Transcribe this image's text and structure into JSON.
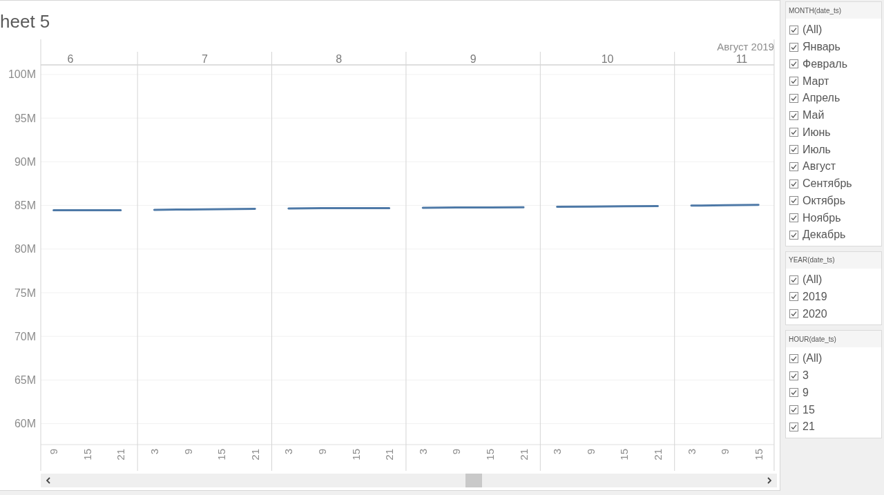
{
  "sheet_title": "heet 5",
  "chart": {
    "header_title": "Август 2019",
    "panes": [
      {
        "header": "6",
        "chart_data": {
          "type": "line",
          "x": [
            9,
            15,
            21
          ],
          "series": [
            {
              "color": "#4e79a7",
              "values": [
                84.45,
                84.46,
                84.46
              ]
            }
          ],
          "xlim": [
            6.7,
            24
          ],
          "ylim": [
            57.6,
            101.1
          ],
          "xticks": [
            9,
            15,
            21
          ],
          "yticks": [
            {
              "value": 60,
              "label": "60M"
            },
            {
              "value": 65,
              "label": "65M"
            },
            {
              "value": 70,
              "label": "70M"
            },
            {
              "value": 75,
              "label": "75M"
            },
            {
              "value": 80,
              "label": "80M"
            },
            {
              "value": 85,
              "label": "85M"
            },
            {
              "value": 90,
              "label": "90M"
            },
            {
              "value": 95,
              "label": "95M"
            },
            {
              "value": 100,
              "label": "100M"
            }
          ],
          "grid": true
        }
      },
      {
        "header": "7",
        "chart_data": {
          "type": "line",
          "x": [
            3,
            9,
            15,
            21
          ],
          "series": [
            {
              "color": "#4e79a7",
              "values": [
                84.5,
                84.54,
                84.58,
                84.62
              ]
            }
          ],
          "xlim": [
            0,
            24
          ],
          "ylim": [
            57.6,
            101.1
          ],
          "xticks": [
            3,
            9,
            15,
            21
          ],
          "grid": true
        }
      },
      {
        "header": "8",
        "chart_data": {
          "type": "line",
          "x": [
            3,
            9,
            15,
            21
          ],
          "series": [
            {
              "color": "#4e79a7",
              "values": [
                84.66,
                84.68,
                84.7,
                84.7
              ]
            }
          ],
          "xlim": [
            0,
            24
          ],
          "ylim": [
            57.6,
            101.1
          ],
          "xticks": [
            3,
            9,
            15,
            21
          ],
          "grid": true
        }
      },
      {
        "header": "9",
        "chart_data": {
          "type": "line",
          "x": [
            3,
            9,
            15,
            21
          ],
          "series": [
            {
              "color": "#4e79a7",
              "values": [
                84.74,
                84.76,
                84.77,
                84.78
              ]
            }
          ],
          "xlim": [
            0,
            24
          ],
          "ylim": [
            57.6,
            101.1
          ],
          "xticks": [
            3,
            9,
            15,
            21
          ],
          "grid": true
        }
      },
      {
        "header": "10",
        "chart_data": {
          "type": "line",
          "x": [
            3,
            9,
            15,
            21
          ],
          "series": [
            {
              "color": "#4e79a7",
              "values": [
                84.84,
                84.87,
                84.9,
                84.92
              ]
            }
          ],
          "xlim": [
            0,
            24
          ],
          "ylim": [
            57.6,
            101.1
          ],
          "xticks": [
            3,
            9,
            15,
            21
          ],
          "grid": true
        }
      },
      {
        "header": "11",
        "chart_data": {
          "type": "line",
          "x": [
            3,
            9,
            15
          ],
          "series": [
            {
              "color": "#4e79a7",
              "values": [
                84.98,
                85.02,
                85.06
              ]
            }
          ],
          "xlim": [
            0,
            17.8
          ],
          "ylim": [
            57.6,
            101.1
          ],
          "xticks": [
            3,
            9,
            15
          ],
          "grid": true
        }
      }
    ]
  },
  "filters": [
    {
      "title": "MONTH(date_ts)",
      "items": [
        {
          "label": "(All)",
          "checked": true
        },
        {
          "label": "Январь",
          "checked": true
        },
        {
          "label": "Февраль",
          "checked": true
        },
        {
          "label": "Март",
          "checked": true
        },
        {
          "label": "Апрель",
          "checked": true
        },
        {
          "label": "Май",
          "checked": true
        },
        {
          "label": "Июнь",
          "checked": true
        },
        {
          "label": "Июль",
          "checked": true
        },
        {
          "label": "Август",
          "checked": true
        },
        {
          "label": "Сентябрь",
          "checked": true
        },
        {
          "label": "Октябрь",
          "checked": true
        },
        {
          "label": "Ноябрь",
          "checked": true
        },
        {
          "label": "Декабрь",
          "checked": true
        }
      ]
    },
    {
      "title": "YEAR(date_ts)",
      "items": [
        {
          "label": "(All)",
          "checked": true
        },
        {
          "label": "2019",
          "checked": true
        },
        {
          "label": "2020",
          "checked": true
        }
      ]
    },
    {
      "title": "HOUR(date_ts)",
      "items": [
        {
          "label": "(All)",
          "checked": true
        },
        {
          "label": "3",
          "checked": true
        },
        {
          "label": "9",
          "checked": true
        },
        {
          "label": "15",
          "checked": true
        },
        {
          "label": "21",
          "checked": true
        }
      ]
    }
  ]
}
